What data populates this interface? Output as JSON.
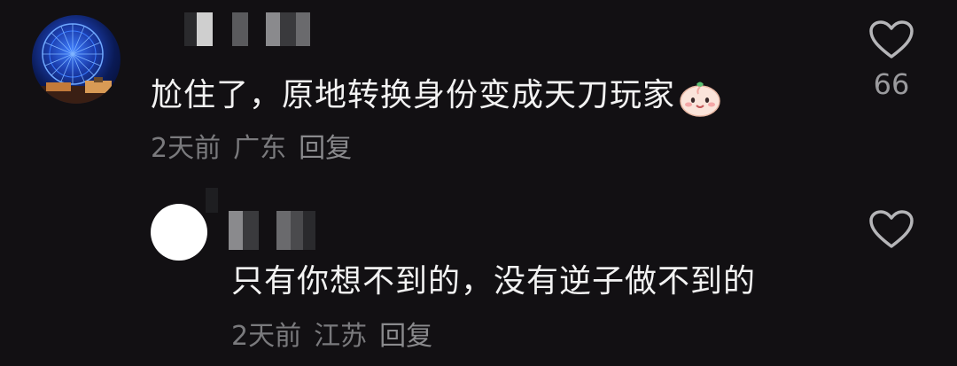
{
  "comments": [
    {
      "text": "尬住了，原地转换身份变成天刀玩家",
      "emoji": "smiling-dumpling-emoji",
      "time": "2天前",
      "location": "广东",
      "reply_label": "回复",
      "likes": "66"
    },
    {
      "text": "只有你想不到的，没有逆子做不到的",
      "time": "2天前",
      "location": "江苏",
      "reply_label": "回复",
      "likes": ""
    }
  ],
  "colors": {
    "background": "#121013",
    "text": "#f2f2f2",
    "meta": "#7a7a7d",
    "icon": "#b5b5b8"
  }
}
